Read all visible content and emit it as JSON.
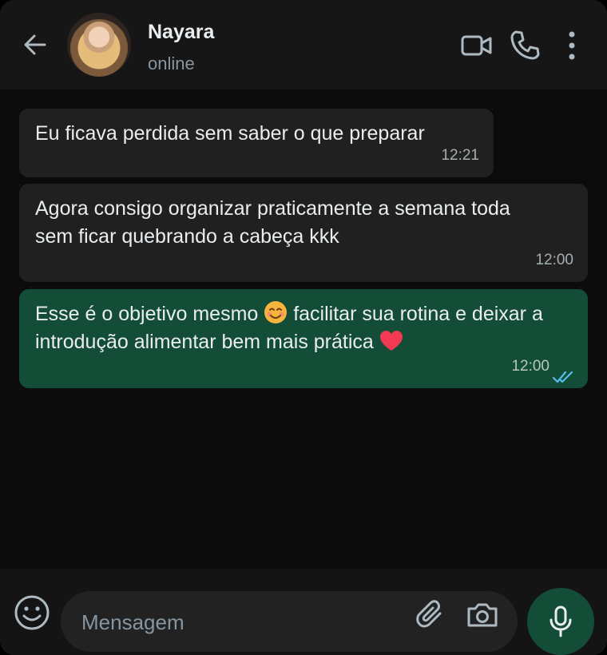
{
  "header": {
    "contact_name": "Nayara",
    "status": "online",
    "icons": [
      "arrow-back-icon",
      "video-call-icon",
      "phone-icon",
      "more-vert-icon"
    ]
  },
  "messages": [
    {
      "direction": "incoming",
      "text": "Eu ficava perdida sem saber o que preparar",
      "time": "12:21"
    },
    {
      "direction": "incoming",
      "text": "Agora consigo organizar praticamente a semana toda sem ficar quebrando a cabeça kkk",
      "time": "12:00"
    },
    {
      "direction": "outgoing",
      "text_part1": "Esse é o objetivo mesmo",
      "emoji1": "smiling-face-emoji",
      "text_part2": "facilitar sua rotina e deixar a introdução alimentar bem mais prática",
      "emoji2": "red-heart-emoji",
      "time": "12:00",
      "status": "read"
    }
  ],
  "composer": {
    "placeholder": "Mensagem",
    "icons": [
      "emoji-icon",
      "attach-icon",
      "camera-icon",
      "mic-icon"
    ]
  },
  "colors": {
    "header_bg": "#161616",
    "chat_bg": "#0b0b0b",
    "incoming_bubble": "#202020",
    "outgoing_bubble": "#144d37",
    "read_ticks": "#53bdeb",
    "text_primary": "#e9edef",
    "text_secondary": "#8696a0"
  }
}
